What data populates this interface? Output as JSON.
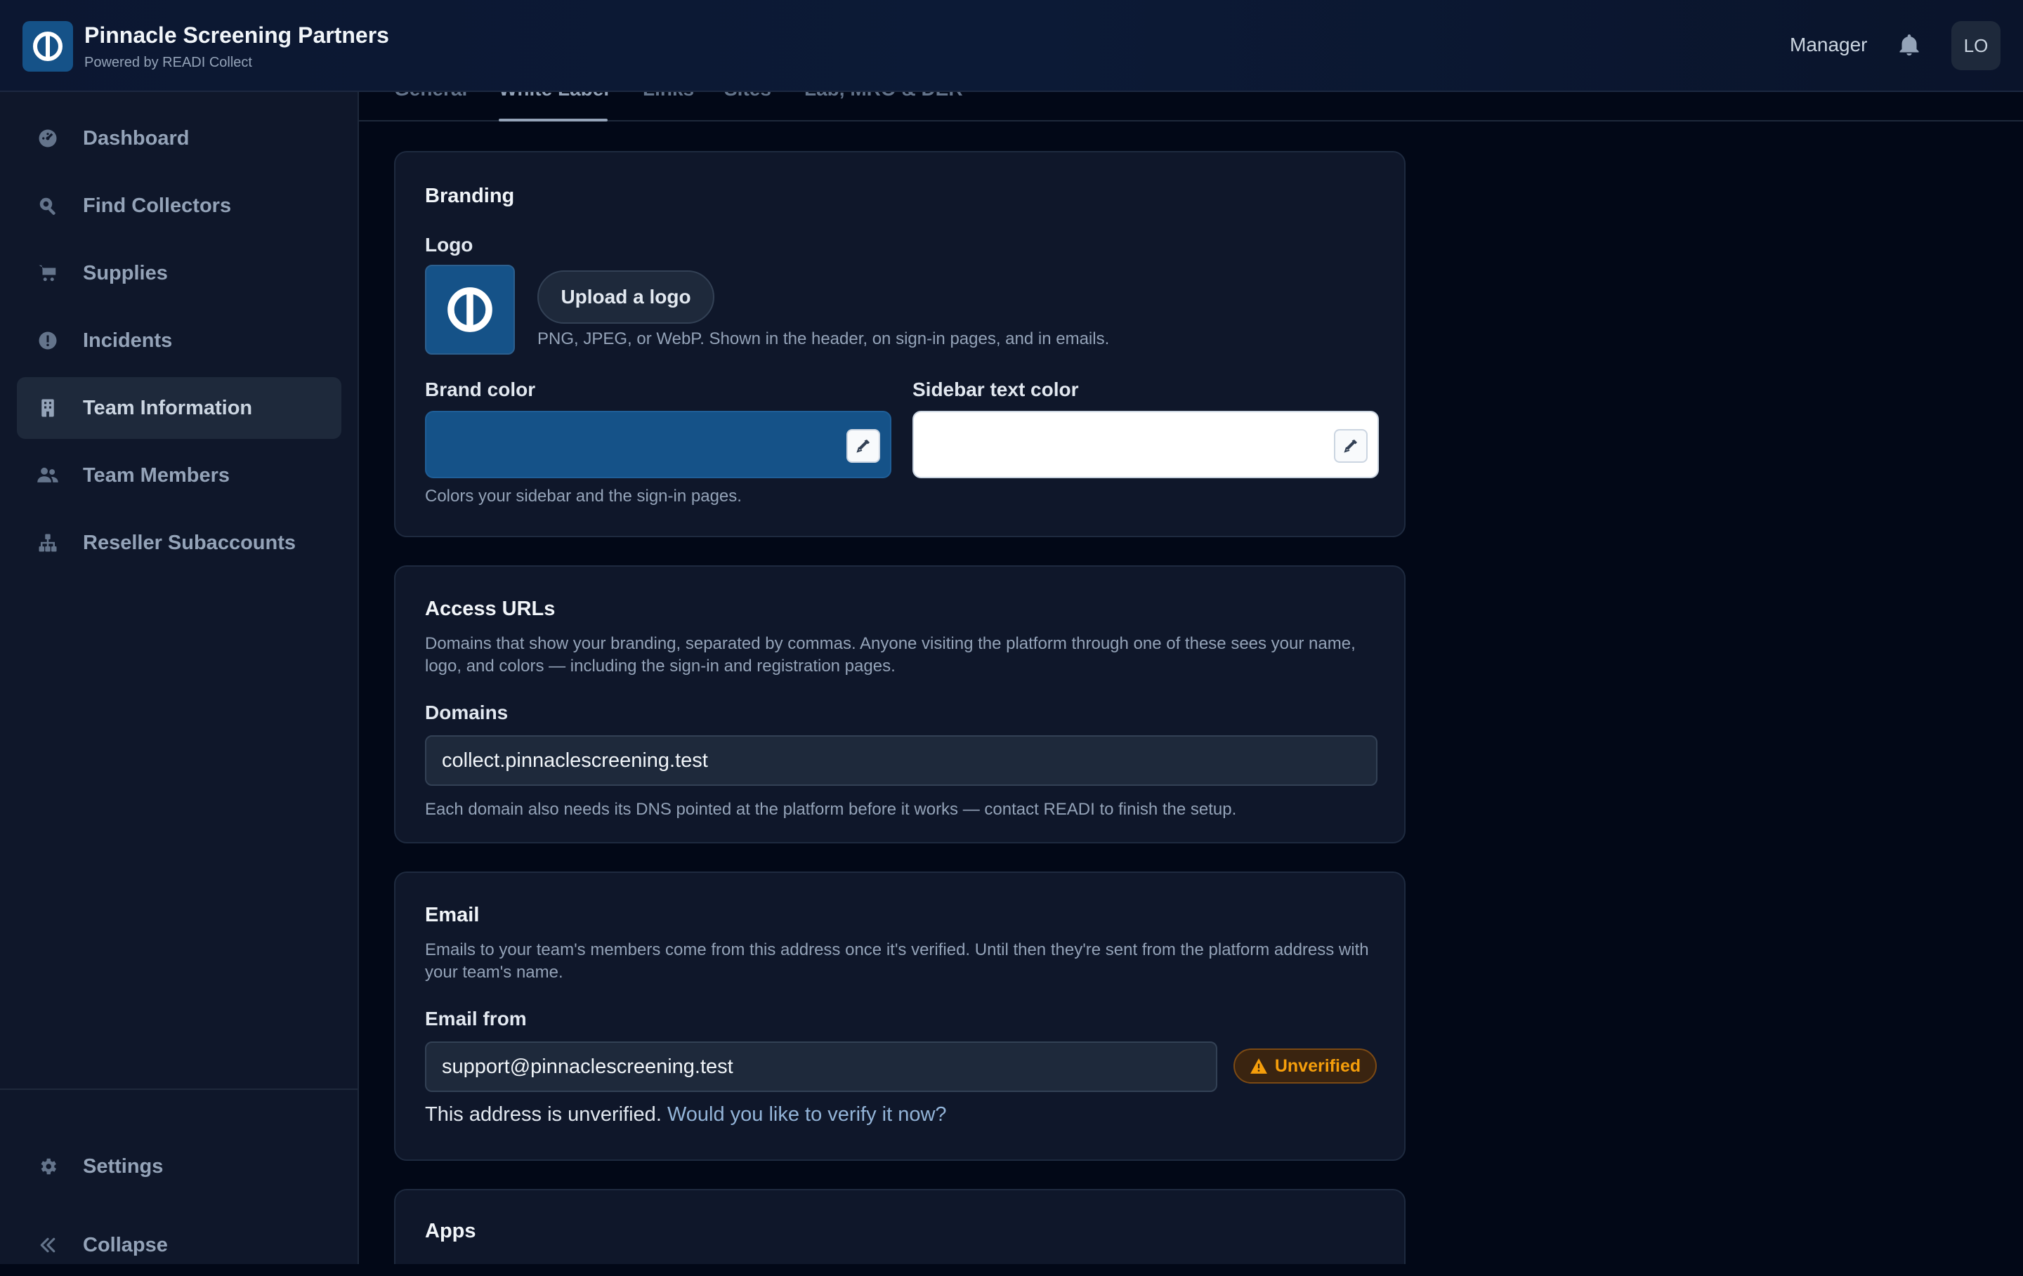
{
  "header": {
    "title": "Pinnacle Screening Partners",
    "subtitle": "Powered by READI Collect",
    "role": "Manager",
    "avatar_initials": "LO"
  },
  "sidebar": {
    "items": [
      {
        "label": "Dashboard",
        "icon": "dashboard-icon"
      },
      {
        "label": "Find Collectors",
        "icon": "search-icon"
      },
      {
        "label": "Supplies",
        "icon": "cart-icon"
      },
      {
        "label": "Incidents",
        "icon": "alert-icon"
      },
      {
        "label": "Team Information",
        "icon": "building-icon",
        "active": true
      },
      {
        "label": "Team Members",
        "icon": "users-icon"
      },
      {
        "label": "Reseller Subaccounts",
        "icon": "hierarchy-icon"
      }
    ],
    "settings_label": "Settings",
    "collapse_label": "Collapse"
  },
  "tabs": [
    {
      "label": "General"
    },
    {
      "label": "White Label",
      "active": true
    },
    {
      "label": "Links"
    },
    {
      "label": "Sites"
    },
    {
      "label": "Lab, MRO & DER"
    }
  ],
  "branding": {
    "title": "Branding",
    "logo_label": "Logo",
    "upload_label": "Upload a logo",
    "logo_help": "PNG, JPEG, or WebP. Shown in the header, on sign-in pages, and in emails.",
    "brand_color_label": "Brand color",
    "brand_color": "#155288",
    "sidebar_text_label": "Sidebar text color",
    "sidebar_text_color": "#ffffff",
    "color_help": "Colors your sidebar and the sign-in pages."
  },
  "access": {
    "title": "Access URLs",
    "description": "Domains that show your branding, separated by commas. Anyone visiting the platform through one of these sees your name, logo, and colors — including the sign-in and registration pages.",
    "domains_label": "Domains",
    "domains_value": "collect.pinnaclescreening.test",
    "domains_help": "Each domain also needs its DNS pointed at the platform before it works — contact READI to finish the setup."
  },
  "email": {
    "title": "Email",
    "description": "Emails to your team's members come from this address once it's verified. Until then they're sent from the platform address with your team's name.",
    "from_label": "Email from",
    "from_value": "support@pinnaclescreening.test",
    "status_badge": "Unverified",
    "unverified_text": "This address is unverified.",
    "verify_link": "Would you like to verify it now?"
  },
  "apps": {
    "title": "Apps"
  }
}
